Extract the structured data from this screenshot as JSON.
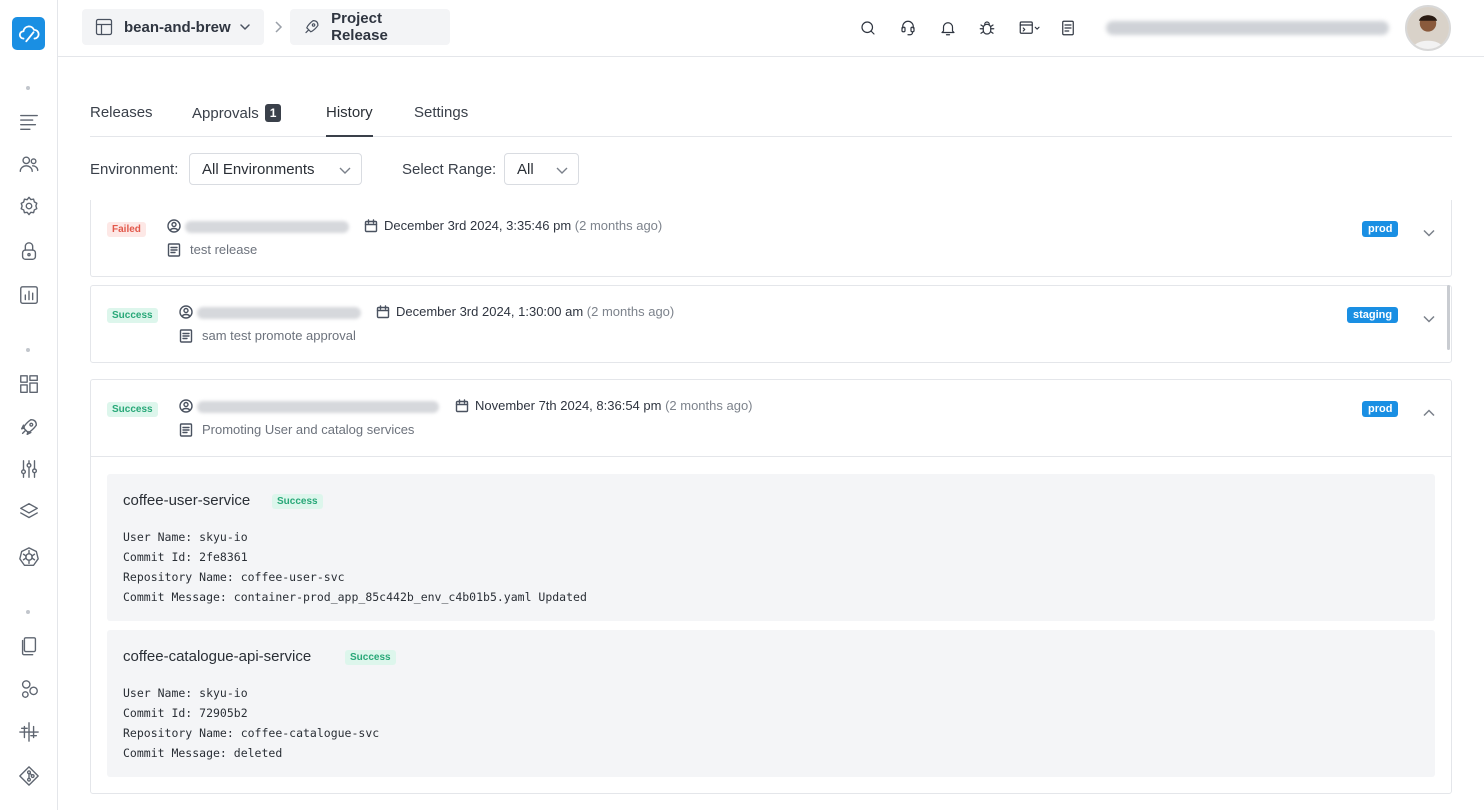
{
  "header": {
    "workspace": "bean-and-brew",
    "project": "Project Release"
  },
  "tabs": {
    "releases": "Releases",
    "approvals": "Approvals",
    "approvals_count": "1",
    "history": "History",
    "settings": "Settings"
  },
  "filters": {
    "environment_label": "Environment:",
    "environment_value": "All Environments",
    "range_label": "Select Range:",
    "range_value": "All"
  },
  "history": [
    {
      "status": "Failed",
      "date": "December 3rd 2024, 3:35:46 pm",
      "ago": "(2 months ago)",
      "note": "test release",
      "env": "prod"
    },
    {
      "status": "Success",
      "date": "December 3rd 2024, 1:30:00 am",
      "ago": "(2 months ago)",
      "note": "sam test promote approval",
      "env": "staging"
    },
    {
      "status": "Success",
      "date": "November 7th 2024, 8:36:54 pm",
      "ago": "(2 months ago)",
      "note": "Promoting User and catalog services",
      "env": "prod",
      "services": [
        {
          "name": "coffee-user-service",
          "status": "Success",
          "user": "User Name: skyu-io",
          "commit": "Commit Id: 2fe8361",
          "repo": "Repository Name: coffee-user-svc",
          "message": "Commit Message: container-prod_app_85c442b_env_c4b01b5.yaml Updated"
        },
        {
          "name": "coffee-catalogue-api-service",
          "status": "Success",
          "user": "User Name: skyu-io",
          "commit": "Commit Id: 72905b2",
          "repo": "Repository Name: coffee-catalogue-svc",
          "message": "Commit Message: deleted"
        }
      ]
    }
  ],
  "colors": {
    "accent": "#1a8fe3",
    "failed": "#e2584b",
    "success": "#28a878"
  }
}
